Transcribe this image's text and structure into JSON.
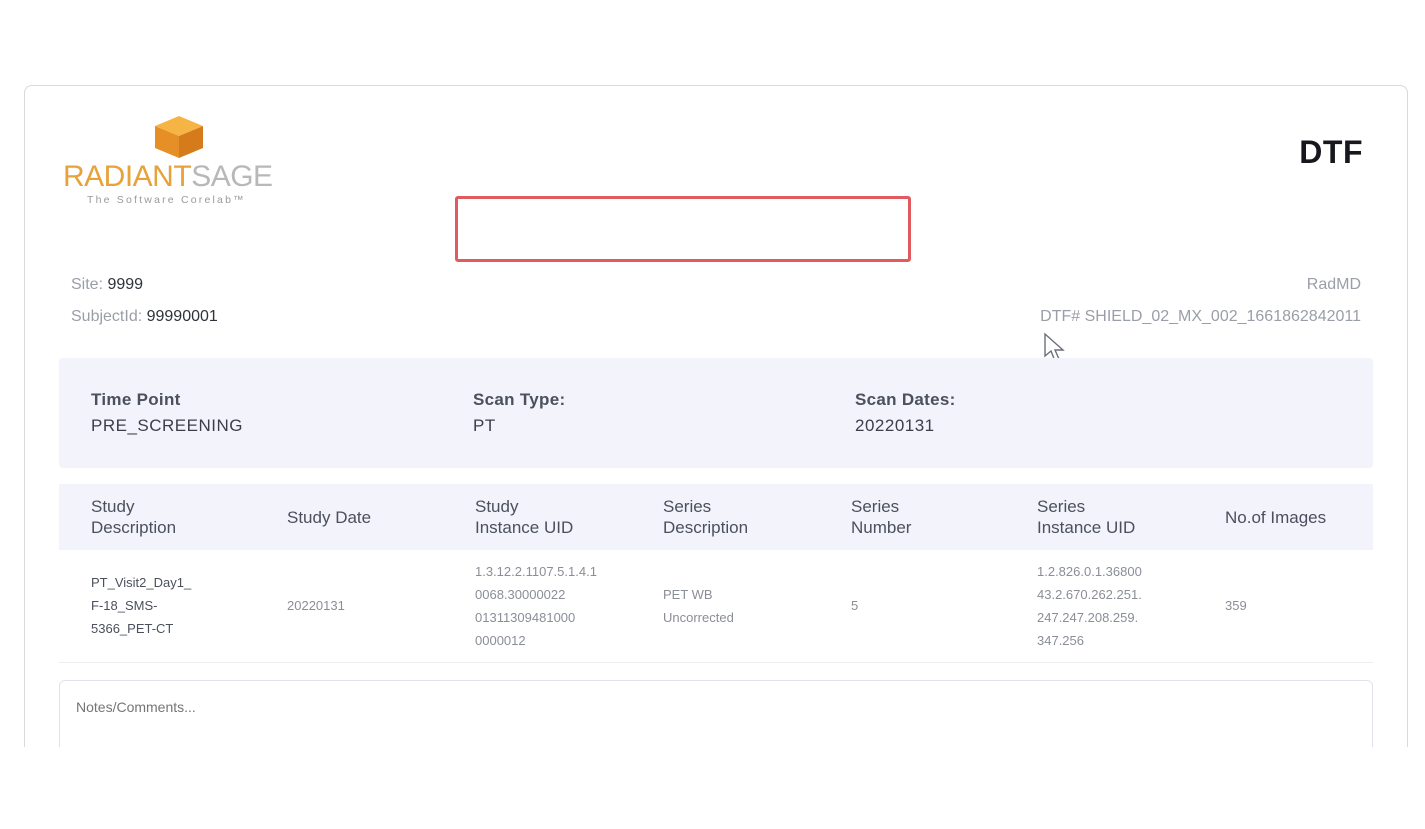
{
  "logo": {
    "brand_part1": "RADIANT",
    "brand_part2": "SAGE",
    "tagline": "The Software Corelab™",
    "colors": {
      "primary": "#e7a23a",
      "secondary": "#b8b8b8"
    }
  },
  "header": {
    "title": "DTF",
    "provider": "RadMD",
    "site_label": "Site: ",
    "site_value": "9999",
    "subject_label": "SubjectId: ",
    "subject_value": "99990001",
    "dtf_label": "DTF# ",
    "dtf_value": "SHIELD_02_MX_002_1661862842011"
  },
  "timepoint": {
    "time_point_label": "Time Point",
    "time_point_value": "PRE_SCREENING",
    "scan_type_label": "Scan Type:",
    "scan_type_value": "PT",
    "scan_dates_label": "Scan Dates:",
    "scan_dates_value": "20220131"
  },
  "study_table": {
    "columns": [
      {
        "line1": "Study",
        "line2": "Description"
      },
      {
        "line1": "Study Date",
        "line2": ""
      },
      {
        "line1": "Study",
        "line2": "Instance UID"
      },
      {
        "line1": "Series",
        "line2": "Description"
      },
      {
        "line1": "Series",
        "line2": "Number"
      },
      {
        "line1": "Series",
        "line2": "Instance UID"
      },
      {
        "line1": "No.of Images",
        "line2": ""
      }
    ],
    "rows": [
      {
        "study_description": [
          "PT_Visit2_Day1_",
          "F-18_SMS-",
          "5366_PET-CT"
        ],
        "study_date": "20220131",
        "study_instance_uid": [
          "1.3.12.2.1107.5.1.4.1",
          "0068.30000022",
          "01311309481000",
          "0000012"
        ],
        "series_description": [
          "PET WB",
          "Uncorrected"
        ],
        "series_number": "5",
        "series_instance_uid": [
          "1.2.826.0.1.36800",
          "43.2.670.262.251.",
          "247.247.208.259.",
          "347.256"
        ],
        "no_of_images": "359"
      }
    ]
  },
  "notes": {
    "placeholder": "Notes/Comments..."
  },
  "accent_colors": {
    "highlight_border": "#e05a60",
    "panel_bg": "#f2f3fb"
  }
}
